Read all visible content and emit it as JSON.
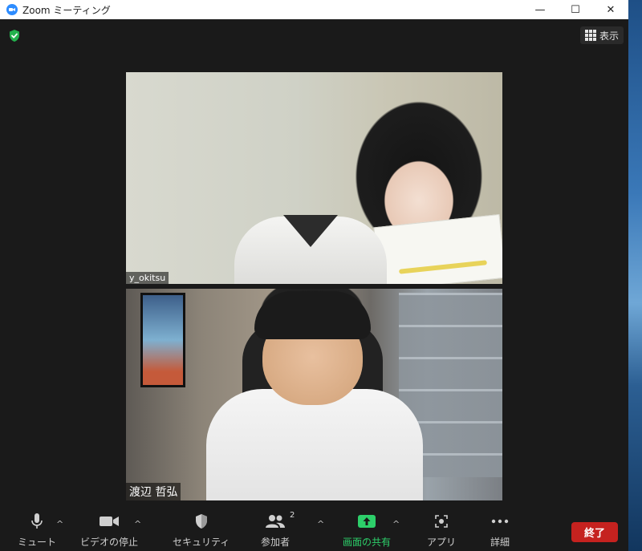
{
  "window": {
    "title": "Zoom ミーティング",
    "controls": {
      "minimize": "—",
      "maximize": "☐",
      "close": "✕"
    }
  },
  "top_bar": {
    "security_icon": "shield-check-icon",
    "view_label": "表示"
  },
  "participants": [
    {
      "name": "y_okitsu"
    },
    {
      "name": "渡辺 哲弘"
    }
  ],
  "toolbar": {
    "mute_label": "ミュート",
    "video_label": "ビデオの停止",
    "security_label": "セキュリティ",
    "participants_label": "参加者",
    "participants_count": "2",
    "share_label": "画面の共有",
    "apps_label": "アプリ",
    "more_label": "詳細",
    "end_label": "終了",
    "caret": "^"
  },
  "colors": {
    "background": "#1a1a1a",
    "share_green": "#2dcf6a",
    "end_red": "#c5221f",
    "shield_green": "#23b14d",
    "zoom_blue": "#2d8cff"
  }
}
